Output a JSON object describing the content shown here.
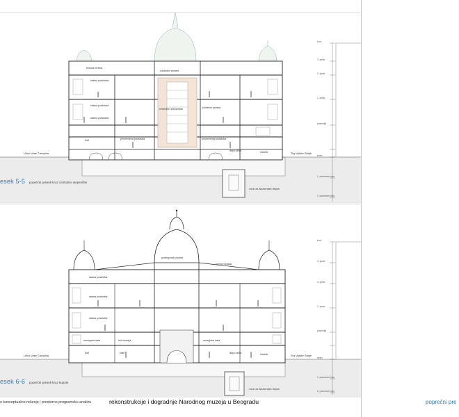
{
  "section_top": {
    "title": "esek 5-5",
    "subtitle": "poprečni presek kroz centralno stepenište",
    "labels": {
      "roof_terrace": "krovna terasa",
      "exhibit_1": "izložbeni prostor",
      "permanent_1": "stalna postavka",
      "permanent_2": "stalna postavka",
      "permanent_3": "stalna postavka",
      "central_stair": "centralno stepenište",
      "exhibit_2": "izložbeni prostor",
      "temporary_1": "privremena postavka",
      "temporary_2": "privremena postavka",
      "depot": "depo slika",
      "hall": "holl",
      "staircase": "hodnik"
    },
    "street_left": "Ulica Vase Čarapića",
    "street_right": "Trg Vojske Srbije",
    "storage": "nove za akušenske depoe"
  },
  "section_bottom": {
    "title": "esek 6-6",
    "subtitle": "poprečni presek kroz kupole",
    "labels": {
      "dome_space": "podkupolni prostor",
      "roof_terrace": "krovna terasa",
      "permanent_1": "stalna postavka",
      "permanent_2": "stalna postavka",
      "permanent_3": "stalna postavka",
      "shop": "muzejska sala",
      "lobby": "hol muzeja",
      "multipurpose": "muzejska sala",
      "depot": "depo slika",
      "cafe": "kafe",
      "lobby2": "holl",
      "staircase": "hodnik"
    },
    "street_left": "Ulica Vase Čarapića",
    "street_right": "Trg Vojske Srbije",
    "storage": "nove za akušenske depoe"
  },
  "scale_levels": {
    "roof": "krov",
    "floor3": "3. sprat",
    "floor2": "2. sprat",
    "floor1": "1. sprat",
    "ground": "prizemlje",
    "terrain": "teren",
    "basement1": "1. podzemni nivo",
    "basement2": "2. podzemni nivo"
  },
  "footer": {
    "small_text": "o konceptualno rešenje i prostorno programsku analizu",
    "big_text": "rekonstrukcije i dogradnje Narodnog muzeja u Beogradu",
    "right_text": "poprečni pre"
  }
}
